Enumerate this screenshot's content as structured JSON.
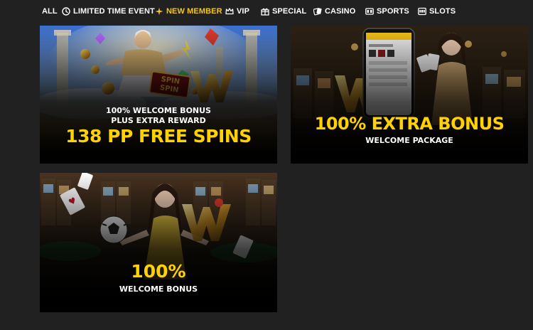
{
  "tabs": [
    {
      "label": "ALL",
      "icon": "none",
      "active": false
    },
    {
      "label": "LIMITED TIME EVENT",
      "icon": "clock-icon",
      "active": false
    },
    {
      "label": "NEW MEMBER",
      "icon": "sparkle-icon",
      "active": true
    },
    {
      "label": "VIP",
      "icon": "crown-icon",
      "active": false
    },
    {
      "label": "SPECIAL",
      "icon": "gift-icon",
      "active": false
    },
    {
      "label": "CASINO",
      "icon": "cards-icon",
      "active": false
    },
    {
      "label": "SPORTS",
      "icon": "scoreboard-icon",
      "active": false
    },
    {
      "label": "SLOTS",
      "icon": "slot-machine-icon",
      "active": false
    }
  ],
  "colors": {
    "background": "#212121",
    "active_tab": "#f5c518",
    "promo_yellow": "#ffd200"
  },
  "promos": [
    {
      "line1": "100% WELCOME BONUS",
      "line2": "PLUS EXTRA REWARD",
      "line3": "138 PP FREE SPINS",
      "art_text": "SPIN SPIN"
    },
    {
      "line1": "100% EXTRA BONUS",
      "line2": "WELCOME PACKAGE"
    },
    {
      "line1": "100%",
      "line2": "WELCOME BONUS"
    }
  ]
}
